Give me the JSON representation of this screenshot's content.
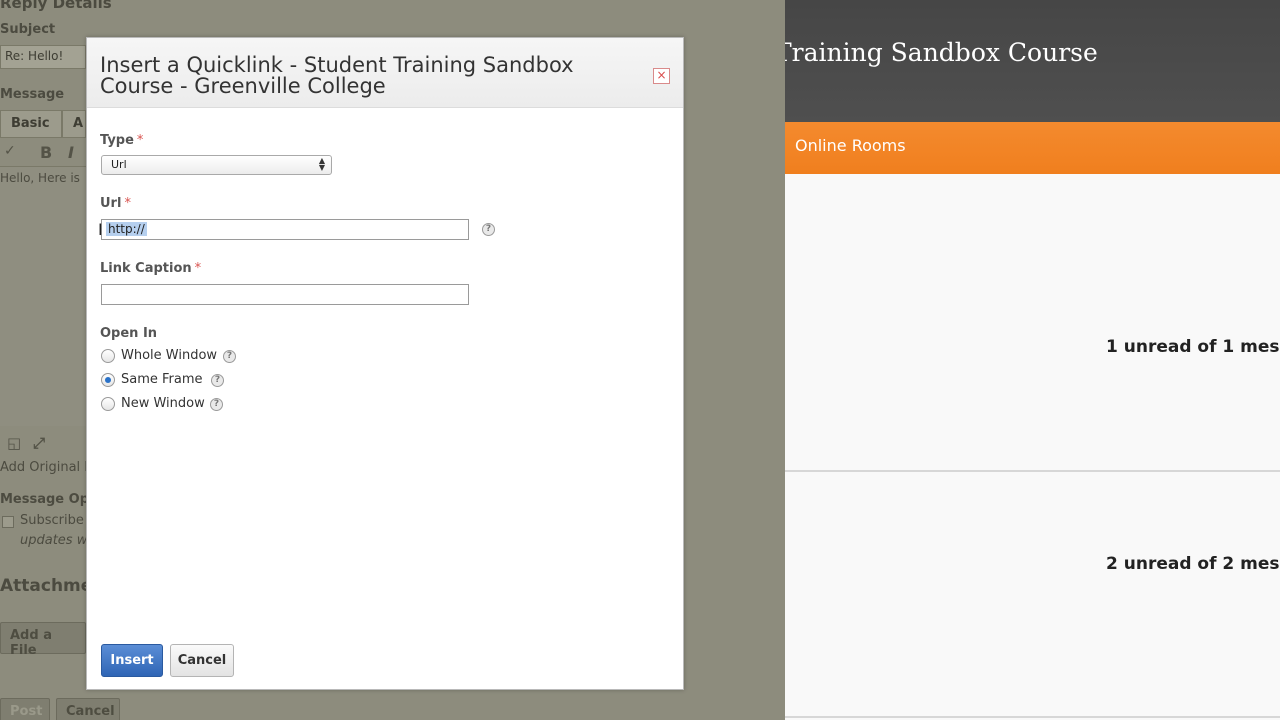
{
  "background_form": {
    "section_title": "Reply Details",
    "subject_label": "Subject",
    "subject_value": "Re: Hello!",
    "message_label": "Message",
    "tab_basic": "Basic",
    "tab_advanced": "A",
    "toolbar_bold": "B",
    "toolbar_italic": "I",
    "message_text": "Hello, Here is",
    "add_original_label": "Add Original I",
    "message_options_label": "Message Op",
    "subscribe_label": "Subscribe",
    "subscribe_hint": "updates w",
    "attachments_label": "Attachme",
    "add_file_button": "Add a File",
    "post_button": "Post",
    "cancel_button": "Cancel"
  },
  "course_page": {
    "title": "Training Sandbox Course",
    "nav_bar_label": "Online Rooms",
    "rooms": [
      {
        "unread": "1 unread of 1 mes"
      },
      {
        "unread": "2 unread of 2 mes"
      }
    ]
  },
  "dialog": {
    "title": "Insert a Quicklink - Student Training Sandbox Course - Greenville College",
    "close_symbol": "×",
    "type_label": "Type",
    "type_value": "Url",
    "url_label": "Url",
    "url_value": "http://",
    "caption_label": "Link Caption",
    "caption_value": "",
    "required_marker": "*",
    "help_symbol": "?",
    "open_in_label": "Open In",
    "open_in_options": [
      {
        "label": "Whole Window",
        "checked": false
      },
      {
        "label": "Same Frame",
        "checked": true
      },
      {
        "label": "New Window",
        "checked": false
      }
    ],
    "insert_label": "Insert",
    "cancel_label": "Cancel"
  },
  "colors": {
    "accent_orange": "#f07f1e",
    "primary_button": "#2f65b5",
    "required_marker": "#d9534f"
  }
}
